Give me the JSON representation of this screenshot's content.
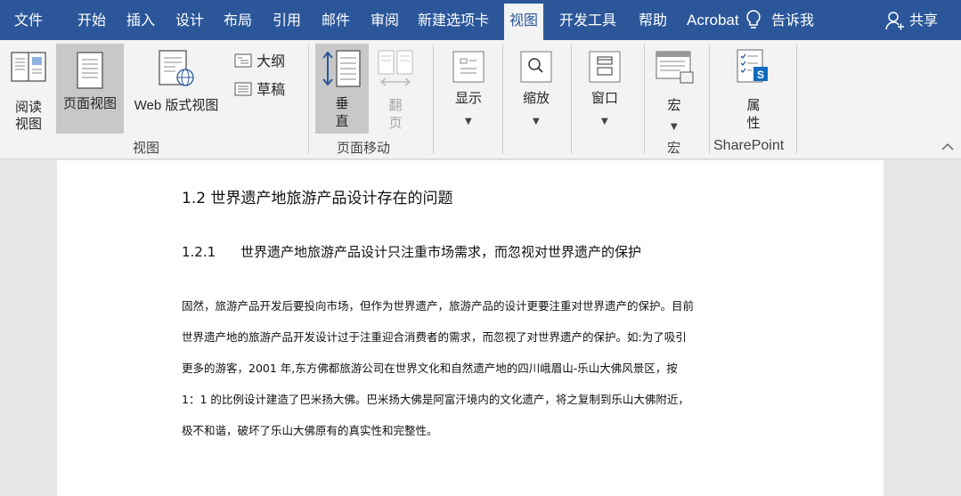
{
  "tabs": [
    {
      "label": "文件"
    },
    {
      "label": "开始"
    },
    {
      "label": "插入"
    },
    {
      "label": "设计"
    },
    {
      "label": "布局"
    },
    {
      "label": "引用"
    },
    {
      "label": "邮件"
    },
    {
      "label": "审阅"
    },
    {
      "label": "新建选项卡"
    },
    {
      "label": "视图",
      "active": true
    },
    {
      "label": "开发工具"
    },
    {
      "label": "帮助"
    },
    {
      "label": "Acrobat"
    },
    {
      "label": "告诉我"
    },
    {
      "label": "共享"
    }
  ],
  "ribbon": {
    "views": {
      "read_mode_1": "阅读",
      "read_mode_2": "视图",
      "print_layout": "页面视图",
      "web_layout": "Web 版式视图",
      "outline": "大纲",
      "draft": "草稿",
      "group_label": "视图"
    },
    "page_movement": {
      "vertical_1": "垂",
      "vertical_2": "直",
      "side_1": "翻",
      "side_2": "页",
      "group_label": "页面移动"
    },
    "show": "显示",
    "zoom": "缩放",
    "window": "窗口",
    "macros": {
      "label": "宏",
      "group_label": "宏"
    },
    "properties": {
      "label_1": "属",
      "label_2": "性",
      "group_label": "SharePoint"
    }
  },
  "document": {
    "heading2": "1.2  世界遗产地旅游产品设计存在的问题",
    "heading3_num": "1.2.1",
    "heading3_text": "世界遗产地旅游产品设计只注重市场需求，而忽视对世界遗产的保护",
    "para_lines": [
      "固然，旅游产品开发后要投向市场，但作为世界遗产，旅游产品的设计更要注重对世界遗产的保护。目前",
      "世界遗产地的旅游产品开发设计过于注重迎合消费者的需求，而忽视了对世界遗产的保护。如:为了吸引",
      "更多的游客，2001 年,东方佛都旅游公司在世界文化和自然遗产地的四川峨眉山-乐山大佛风景区，按",
      "1：1  的比例设计建造了巴米扬大佛。巴米扬大佛是阿富汗境内的文化遗产，将之复制到乐山大佛附近，",
      "极不和谐，破坏了乐山大佛原有的真实性和完整性。"
    ]
  },
  "colors": {
    "titlebar": "#2b579a",
    "ribbon": "#f3f3f3",
    "selected": "#c8c8c8"
  }
}
